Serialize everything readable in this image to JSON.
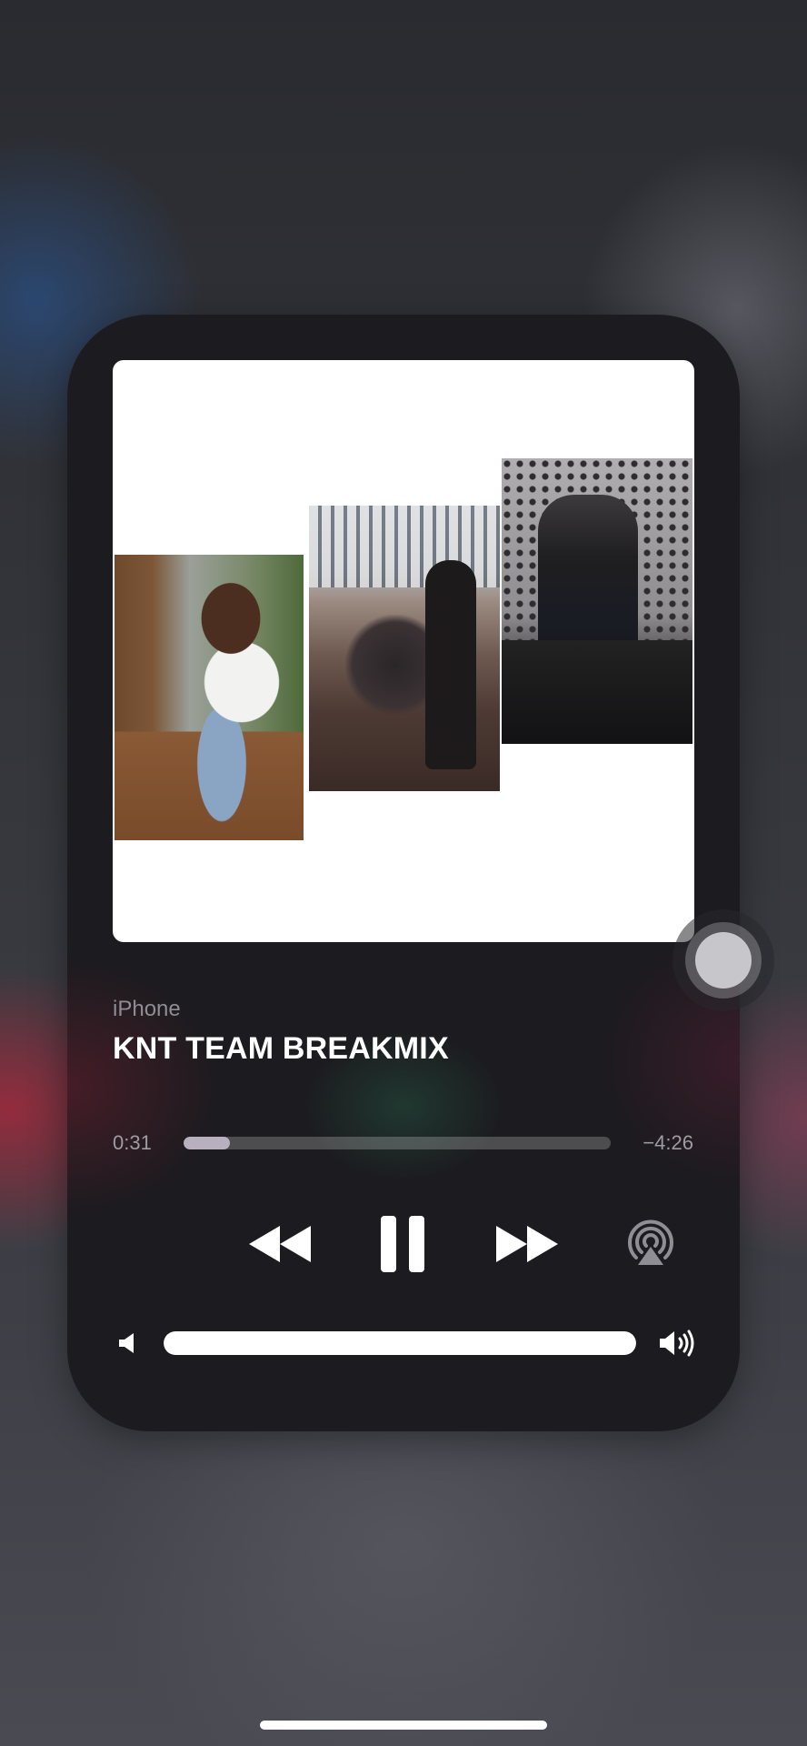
{
  "now_playing": {
    "source": "iPhone",
    "title": "KNT TEAM BREAKMIX",
    "elapsed": "0:31",
    "remaining": "−4:26",
    "progress_fraction": 0.108
  },
  "controls": {
    "rewind_icon": "rewind-icon",
    "pause_icon": "pause-icon",
    "forward_icon": "fast-forward-icon",
    "airplay_icon": "airplay-icon"
  },
  "volume": {
    "level_fraction": 1.0,
    "low_icon": "speaker-low-icon",
    "high_icon": "speaker-high-icon"
  },
  "colors": {
    "panel": "#1c1b1f",
    "progress_fill": "#b8b0bf",
    "text_primary": "#ffffff",
    "text_secondary": "#8e8d93"
  }
}
